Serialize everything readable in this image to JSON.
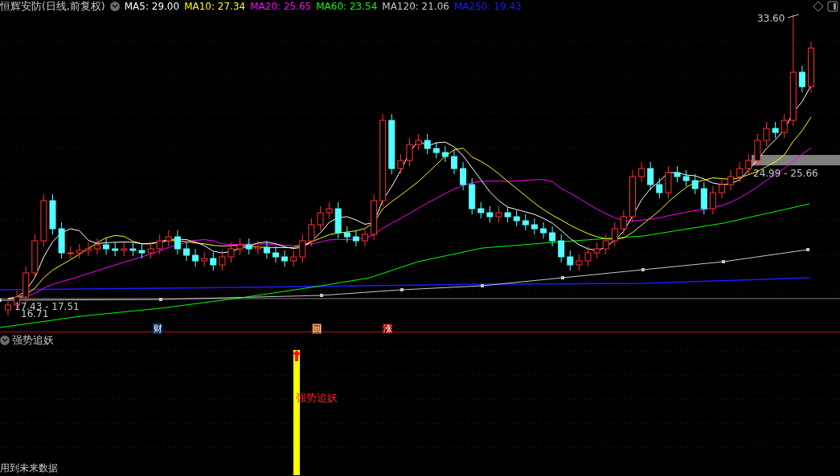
{
  "title": "恒辉安防(日线,前复权)",
  "ma_legend": [
    {
      "label": "MA5: 29.00",
      "color": "#ffffff"
    },
    {
      "label": "MA10: 27.34",
      "color": "#ffff00"
    },
    {
      "label": "MA20: 25.65",
      "color": "#ff00ff"
    },
    {
      "label": "MA60: 23.54",
      "color": "#00ff00"
    },
    {
      "label": "MA120: 21.06",
      "color": "#c8c8c8"
    },
    {
      "label": "MA250: 19.43",
      "color": "#1c1cff"
    }
  ],
  "price_labels": {
    "high": "33.60",
    "band": "24.99 - 25.66",
    "low_range": "17.43 - 17.51",
    "low": "16.71"
  },
  "event_markers": [
    {
      "text": "财",
      "kind": "finance"
    },
    {
      "text": "回",
      "kind": "buyback"
    },
    {
      "text": "涨",
      "kind": "rise"
    }
  ],
  "indicator": {
    "title": "强势追妖",
    "signal_label": "强势追妖",
    "note": "用到未来数据"
  }
}
